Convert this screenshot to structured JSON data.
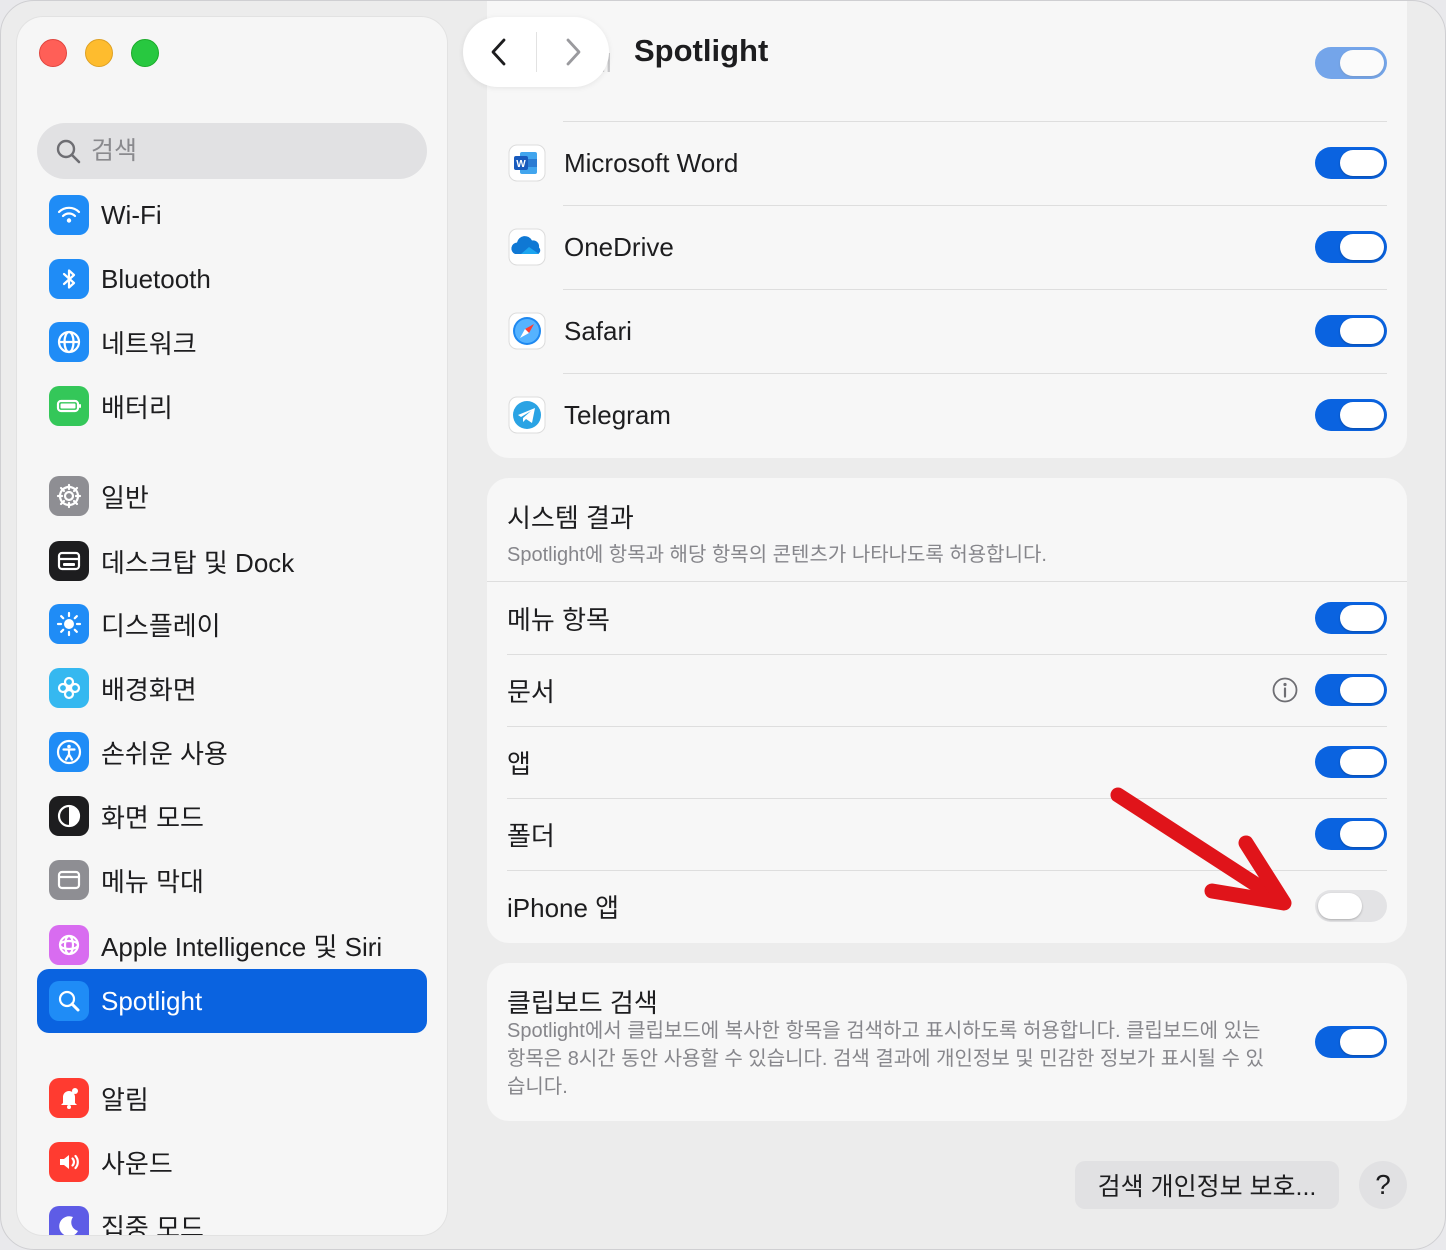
{
  "window": {
    "title": "Spotlight"
  },
  "sidebar": {
    "search_placeholder": "검색",
    "items": [
      {
        "label": "Wi-Fi",
        "icon": "wifi-icon",
        "color": "#1f8cf6"
      },
      {
        "label": "Bluetooth",
        "icon": "bluetooth-icon",
        "color": "#1f8cf6"
      },
      {
        "label": "네트워크",
        "icon": "globe-icon",
        "color": "#1f8cf6"
      },
      {
        "label": "배터리",
        "icon": "battery-icon",
        "color": "#34c759"
      },
      {
        "label": "일반",
        "icon": "gear-icon",
        "color": "#8e8e93"
      },
      {
        "label": "데스크탑 및 Dock",
        "icon": "dock-icon",
        "color": "#1d1d1f"
      },
      {
        "label": "디스플레이",
        "icon": "sun-icon",
        "color": "#1f8cf6"
      },
      {
        "label": "배경화면",
        "icon": "flower-icon",
        "color": "#35b8f0"
      },
      {
        "label": "손쉬운 사용",
        "icon": "accessibility-icon",
        "color": "#1f8cf6"
      },
      {
        "label": "화면 모드",
        "icon": "appearance-icon",
        "color": "#1d1d1f"
      },
      {
        "label": "메뉴 막대",
        "icon": "menubar-icon",
        "color": "#8e8e93"
      },
      {
        "label": "Apple Intelligence 및 Siri",
        "icon": "siri-icon",
        "color": "#d86cf0"
      },
      {
        "label": "Spotlight",
        "icon": "spotlight-icon",
        "color": "#1f8cf6",
        "active": true
      },
      {
        "label": "알림",
        "icon": "bell-icon",
        "color": "#ff3b30"
      },
      {
        "label": "사운드",
        "icon": "speaker-icon",
        "color": "#ff3b30"
      },
      {
        "label": "집중 모드",
        "icon": "moon-icon",
        "color": "#5e5ce6"
      }
    ]
  },
  "main": {
    "title": "Spotlight",
    "apps": [
      {
        "name": "Microsoft Word",
        "icon": "word-icon",
        "enabled": true
      },
      {
        "name": "OneDrive",
        "icon": "onedrive-icon",
        "enabled": true
      },
      {
        "name": "Safari",
        "icon": "safari-icon",
        "enabled": true
      },
      {
        "name": "Telegram",
        "icon": "telegram-icon",
        "enabled": true
      }
    ],
    "system_results": {
      "title": "시스템 결과",
      "subtitle": "Spotlight에 항목과 해당 항목의 콘텐츠가 나타나도록 허용합니다.",
      "options": [
        {
          "label": "메뉴 항목",
          "enabled": true
        },
        {
          "label": "문서",
          "enabled": true,
          "info": true
        },
        {
          "label": "앱",
          "enabled": true
        },
        {
          "label": "폴더",
          "enabled": true
        },
        {
          "label": "iPhone 앱",
          "enabled": false
        }
      ]
    },
    "clipboard": {
      "title": "클립보드 검색",
      "description": "Spotlight에서 클립보드에 복사한 항목을 검색하고 표시하도록 허용합니다. 클립보드에 있는 항목은 8시간 동안 사용할 수 있습니다. 검색 결과에 개인정보 및 민감한 정보가 표시될 수 있습니다.",
      "enabled": true
    },
    "privacy_button": "검색 개인정보 보호...",
    "help_button": "?"
  },
  "colors": {
    "accent": "#0a63e0",
    "annotation_arrow": "#e0141a"
  }
}
